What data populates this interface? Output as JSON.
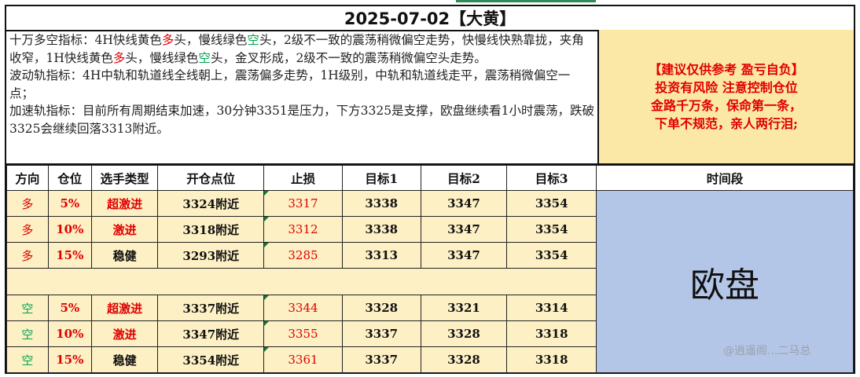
{
  "title": "2025-07-02【大黄】",
  "analysis": {
    "p1_a": "十万多空指标：4H快线黄色",
    "p1_b": "多",
    "p1_c": "头，慢线绿色",
    "p1_d": "空",
    "p1_e": "头，2级不一致的震荡稍微偏空走势，快慢线快熟靠拢，夹角收窄，1H快线黄色",
    "p1_f": "多",
    "p1_g": "头，慢线绿色",
    "p1_h": "空",
    "p1_i": "头，金叉形成，2级不一致的震荡稍微偏空头走势。",
    "p2": "波动轨指标：4H中轨和轨道线全线朝上，震荡偏多走势，1H级别，中轨和轨道线走平，震荡稍微偏空一点；",
    "p3": "加速轨指标：目前所有周期结束加速，30分钟3351是压力，下方3325是支撑，欧盘继续看1小时震荡，跌破3325会继续回落3313附近。"
  },
  "advice": {
    "line1": "【建议仅供参考  盈亏自负】",
    "line2": "投资有风险  注意控制仓位",
    "line3": "金路千万条，保命第一条，",
    "line4": "下单不规范，亲人两行泪;"
  },
  "table": {
    "headers": [
      "方向",
      "仓位",
      "选手类型",
      "开仓点位",
      "止损",
      "目标1",
      "目标2",
      "目标3",
      "时间段"
    ],
    "long_rows": [
      {
        "dir": "多",
        "pos": "5%",
        "type": "超激进",
        "entry": "3324附近",
        "stop": "3317",
        "t1": "3338",
        "t2": "3347",
        "t3": "3354"
      },
      {
        "dir": "多",
        "pos": "10%",
        "type": "激进",
        "entry": "3318附近",
        "stop": "3312",
        "t1": "3338",
        "t2": "3347",
        "t3": "3354"
      },
      {
        "dir": "多",
        "pos": "15%",
        "type": "稳健",
        "entry": "3293附近",
        "stop": "3285",
        "t1": "3313",
        "t2": "3347",
        "t3": "3354"
      }
    ],
    "short_rows": [
      {
        "dir": "空",
        "pos": "5%",
        "type": "超激进",
        "entry": "3337附近",
        "stop": "3344",
        "t1": "3328",
        "t2": "3321",
        "t3": "3314"
      },
      {
        "dir": "空",
        "pos": "10%",
        "type": "激进",
        "entry": "3347附近",
        "stop": "3355",
        "t1": "3337",
        "t2": "3328",
        "t3": "3318"
      },
      {
        "dir": "空",
        "pos": "15%",
        "type": "稳健",
        "entry": "3354附近",
        "stop": "3361",
        "t1": "3337",
        "t2": "3328",
        "t3": "3318"
      }
    ],
    "session": "欧盘"
  },
  "watermark": "@逍遥阁...二马总",
  "colors": {
    "long": "#e00000",
    "short": "#00a550",
    "fast_line": "#d1a700",
    "advice_bg": "#fce8a6",
    "row_bg": "#fdf0c4",
    "session_bg": "#b4c6e7"
  }
}
